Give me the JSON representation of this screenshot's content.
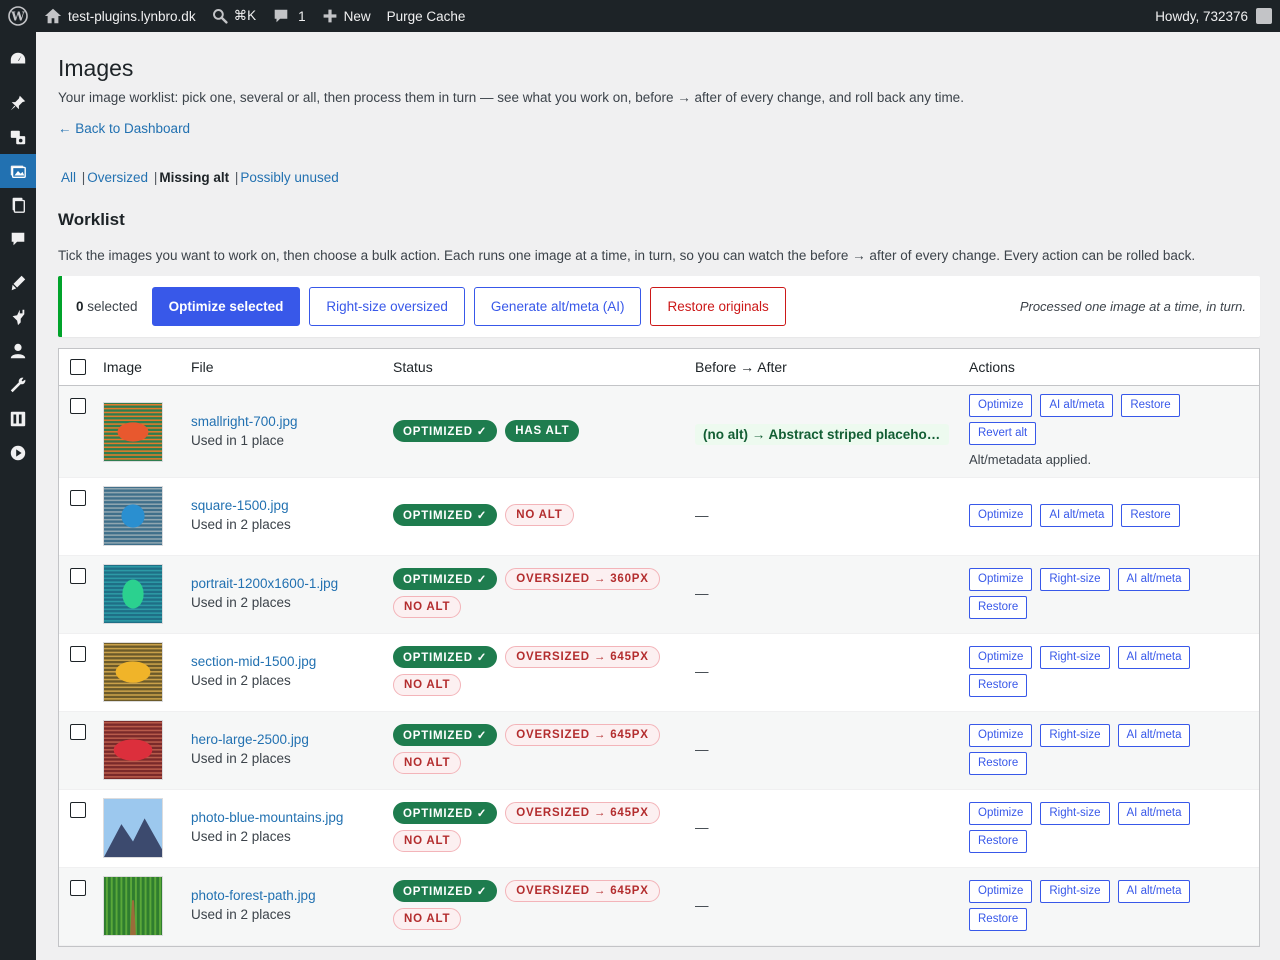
{
  "adminbar": {
    "site": "test-plugins.lynbro.dk",
    "search_shortcut": "⌘K",
    "comments": "1",
    "new_label": "New",
    "purge": "Purge Cache",
    "howdy": "Howdy, 732376"
  },
  "page": {
    "title": "Images",
    "description": "Your image worklist: pick one, several or all, then process them in turn — see what you work on, before → after of every change, and roll back any time.",
    "back_link": "← Back to Dashboard"
  },
  "filters": {
    "all": "All",
    "oversized": "Oversized",
    "missing_alt": "Missing alt",
    "unused": "Possibly unused",
    "separator": "|"
  },
  "worklist": {
    "title": "Worklist",
    "description": "Tick the images you want to work on, then choose a bulk action. Each runs one image at a time, in turn, so you can watch the before → after of every change. Every action can be rolled back."
  },
  "bulk": {
    "count": "0",
    "selected_label": "selected",
    "optimize": "Optimize selected",
    "rightsize": "Right-size oversized",
    "generate": "Generate alt/meta (AI)",
    "restore": "Restore originals",
    "note": "Processed one image at a time, in turn."
  },
  "table": {
    "headers": {
      "image": "Image",
      "file": "File",
      "status": "Status",
      "before_after": "Before → After",
      "actions": "Actions"
    },
    "rows": [
      {
        "file": "smallright-700.jpg",
        "used": "Used in 1 place",
        "badges": [
          {
            "text": "OPTIMIZED ✓",
            "kind": "ok"
          },
          {
            "text": "HAS ALT",
            "kind": "ok"
          }
        ],
        "before_after": "(no alt) → Abstract striped placehol...",
        "actions": [
          "Optimize",
          "AI alt/meta",
          "Restore",
          "Revert alt"
        ],
        "note": "Alt/metadata applied."
      },
      {
        "file": "square-1500.jpg",
        "used": "Used in 2 places",
        "badges": [
          {
            "text": "OPTIMIZED ✓",
            "kind": "ok"
          },
          {
            "text": "NO ALT",
            "kind": "warn"
          }
        ],
        "before_after": "—",
        "actions": [
          "Optimize",
          "AI alt/meta",
          "Restore"
        ]
      },
      {
        "file": "portrait-1200x1600-1.jpg",
        "used": "Used in 2 places",
        "badges": [
          {
            "text": "OPTIMIZED ✓",
            "kind": "ok"
          },
          {
            "text": "OVERSIZED → 360PX",
            "kind": "warn"
          },
          {
            "text": "NO ALT",
            "kind": "warn"
          }
        ],
        "before_after": "—",
        "actions": [
          "Optimize",
          "Right-size",
          "AI alt/meta",
          "Restore"
        ]
      },
      {
        "file": "section-mid-1500.jpg",
        "used": "Used in 2 places",
        "badges": [
          {
            "text": "OPTIMIZED ✓",
            "kind": "ok"
          },
          {
            "text": "OVERSIZED → 645PX",
            "kind": "warn"
          },
          {
            "text": "NO ALT",
            "kind": "warn"
          }
        ],
        "before_after": "—",
        "actions": [
          "Optimize",
          "Right-size",
          "AI alt/meta",
          "Restore"
        ]
      },
      {
        "file": "hero-large-2500.jpg",
        "used": "Used in 2 places",
        "badges": [
          {
            "text": "OPTIMIZED ✓",
            "kind": "ok"
          },
          {
            "text": "OVERSIZED → 645PX",
            "kind": "warn"
          },
          {
            "text": "NO ALT",
            "kind": "warn"
          }
        ],
        "before_after": "—",
        "actions": [
          "Optimize",
          "Right-size",
          "AI alt/meta",
          "Restore"
        ]
      },
      {
        "file": "photo-blue-mountains.jpg",
        "used": "Used in 2 places",
        "badges": [
          {
            "text": "OPTIMIZED ✓",
            "kind": "ok"
          },
          {
            "text": "OVERSIZED → 645PX",
            "kind": "warn"
          },
          {
            "text": "NO ALT",
            "kind": "warn"
          }
        ],
        "before_after": "—",
        "actions": [
          "Optimize",
          "Right-size",
          "AI alt/meta",
          "Restore"
        ]
      },
      {
        "file": "photo-forest-path.jpg",
        "used": "Used in 2 places",
        "badges": [
          {
            "text": "OPTIMIZED ✓",
            "kind": "ok"
          },
          {
            "text": "OVERSIZED → 645PX",
            "kind": "warn"
          },
          {
            "text": "NO ALT",
            "kind": "warn"
          }
        ],
        "before_after": "—",
        "actions": [
          "Optimize",
          "Right-size",
          "AI alt/meta",
          "Restore"
        ]
      }
    ]
  },
  "colors": {
    "accent": "#3858e9",
    "ok": "#1e7c4e",
    "warn": "#b32d2e",
    "danger": "#cc1818",
    "sidebar": "#1d2327",
    "link": "#2271b1"
  },
  "icons": [
    "wordpress-logo-icon",
    "home-icon",
    "search-icon",
    "comment-icon",
    "plus-icon",
    "dashboard-icon",
    "pin-icon",
    "media-icon",
    "images-icon",
    "pages-icon",
    "comments-icon",
    "appearance-icon",
    "plugins-icon",
    "users-icon",
    "tools-icon",
    "settings-icon",
    "play-icon"
  ]
}
